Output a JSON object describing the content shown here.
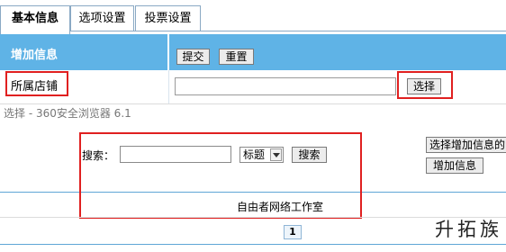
{
  "tabs": [
    {
      "label": "基本信息",
      "active": true
    },
    {
      "label": "选项设置",
      "active": false
    },
    {
      "label": "投票设置",
      "active": false
    }
  ],
  "form": {
    "header_label": "增加信息",
    "submit_label": "提交",
    "reset_label": "重置",
    "store_label": "所属店铺",
    "store_value": "",
    "choose_label": "选择"
  },
  "dialog": {
    "title": "选择 - 360安全浏览器 6.1",
    "search_label": "搜索：",
    "search_value": "",
    "select_value": "标题",
    "search_button": "搜索",
    "right_button_1": "选择增加信息的",
    "right_button_2": "增加信息",
    "studio_text": "自由者网络工作室",
    "page_number": "1"
  },
  "watermark": "升拓族",
  "colors": {
    "header_blue": "#5fb3e6",
    "highlight_red": "#e02020"
  }
}
